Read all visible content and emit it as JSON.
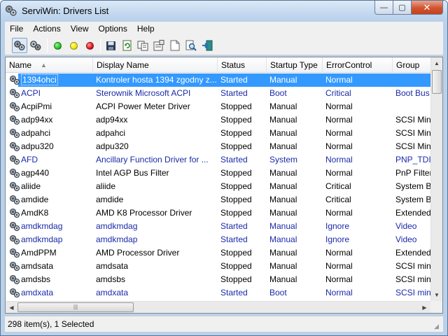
{
  "window": {
    "title": "ServiWin: Drivers List"
  },
  "titlebar_buttons": {
    "minimize": "—",
    "maximize": "▢",
    "close": "✕"
  },
  "menu": [
    "File",
    "Actions",
    "View",
    "Options",
    "Help"
  ],
  "toolbar": {
    "icons": [
      "drivers-view-icon",
      "services-view-icon",
      "start-icon",
      "pause-icon",
      "stop-icon",
      "save-icon",
      "refresh-icon",
      "copy-icon",
      "properties-icon",
      "html-report-icon",
      "find-icon",
      "exit-icon"
    ],
    "colors": {
      "start": "#22c322",
      "pause": "#f2e600",
      "stop": "#e0151b"
    }
  },
  "columns": [
    "Name",
    "Display Name",
    "Status",
    "Startup Type",
    "ErrorControl",
    "Group"
  ],
  "rows": [
    {
      "name": "1394ohci",
      "display": "Kontroler hosta 1394 zgodny z...",
      "status": "Started",
      "startup": "Manual",
      "error": "Normal",
      "group": "",
      "selected": true
    },
    {
      "name": "ACPI",
      "display": "Sterownik Microsoft ACPI",
      "status": "Started",
      "startup": "Boot",
      "error": "Critical",
      "group": "Boot Bus"
    },
    {
      "name": "AcpiPmi",
      "display": "ACPI Power Meter Driver",
      "status": "Stopped",
      "startup": "Manual",
      "error": "Normal",
      "group": ""
    },
    {
      "name": "adp94xx",
      "display": "adp94xx",
      "status": "Stopped",
      "startup": "Manual",
      "error": "Normal",
      "group": "SCSI Mini"
    },
    {
      "name": "adpahci",
      "display": "adpahci",
      "status": "Stopped",
      "startup": "Manual",
      "error": "Normal",
      "group": "SCSI Mini"
    },
    {
      "name": "adpu320",
      "display": "adpu320",
      "status": "Stopped",
      "startup": "Manual",
      "error": "Normal",
      "group": "SCSI Mini"
    },
    {
      "name": "AFD",
      "display": "Ancillary Function Driver for ...",
      "status": "Started",
      "startup": "System",
      "error": "Normal",
      "group": "PNP_TDI"
    },
    {
      "name": "agp440",
      "display": "Intel AGP Bus Filter",
      "status": "Stopped",
      "startup": "Manual",
      "error": "Normal",
      "group": "PnP Filter"
    },
    {
      "name": "aliide",
      "display": "aliide",
      "status": "Stopped",
      "startup": "Manual",
      "error": "Critical",
      "group": "System B"
    },
    {
      "name": "amdide",
      "display": "amdide",
      "status": "Stopped",
      "startup": "Manual",
      "error": "Critical",
      "group": "System B"
    },
    {
      "name": "AmdK8",
      "display": "AMD K8 Processor Driver",
      "status": "Stopped",
      "startup": "Manual",
      "error": "Normal",
      "group": "Extended"
    },
    {
      "name": "amdkmdag",
      "display": "amdkmdag",
      "status": "Started",
      "startup": "Manual",
      "error": "Ignore",
      "group": "Video"
    },
    {
      "name": "amdkmdap",
      "display": "amdkmdap",
      "status": "Started",
      "startup": "Manual",
      "error": "Ignore",
      "group": "Video"
    },
    {
      "name": "AmdPPM",
      "display": "AMD Processor Driver",
      "status": "Stopped",
      "startup": "Manual",
      "error": "Normal",
      "group": "Extended"
    },
    {
      "name": "amdsata",
      "display": "amdsata",
      "status": "Stopped",
      "startup": "Manual",
      "error": "Normal",
      "group": "SCSI mini"
    },
    {
      "name": "amdsbs",
      "display": "amdsbs",
      "status": "Stopped",
      "startup": "Manual",
      "error": "Normal",
      "group": "SCSI mini"
    },
    {
      "name": "amdxata",
      "display": "amdxata",
      "status": "Started",
      "startup": "Boot",
      "error": "Normal",
      "group": "SCSI mini"
    }
  ],
  "status": {
    "text": "298 item(s), 1 Selected"
  },
  "colors": {
    "started_text": "#1a2aa7",
    "selection": "#3399ff"
  }
}
